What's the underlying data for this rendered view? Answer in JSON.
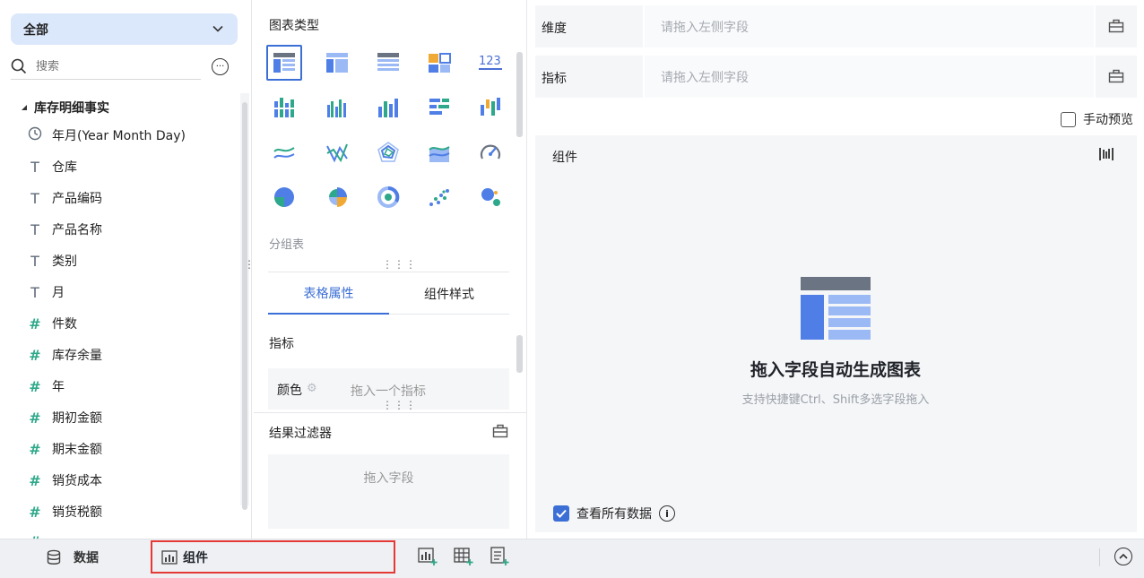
{
  "left": {
    "scope": "全部",
    "search_placeholder": "搜索",
    "tree_root": "库存明细事实",
    "fields": [
      {
        "label": "年月(Year Month Day)",
        "icon": "clock-icon",
        "type": "date"
      },
      {
        "label": "仓库",
        "icon": "text-type-icon",
        "type": "text"
      },
      {
        "label": "产品编码",
        "icon": "text-type-icon",
        "type": "text"
      },
      {
        "label": "产品名称",
        "icon": "text-type-icon",
        "type": "text"
      },
      {
        "label": "类别",
        "icon": "text-type-icon",
        "type": "text"
      },
      {
        "label": "月",
        "icon": "text-type-icon",
        "type": "text"
      },
      {
        "label": "件数",
        "icon": "number-type-icon",
        "type": "number"
      },
      {
        "label": "库存余量",
        "icon": "number-type-icon",
        "type": "number"
      },
      {
        "label": "年",
        "icon": "number-type-icon",
        "type": "number"
      },
      {
        "label": "期初金额",
        "icon": "number-type-icon",
        "type": "number"
      },
      {
        "label": "期末金额",
        "icon": "number-type-icon",
        "type": "number"
      },
      {
        "label": "销货成本",
        "icon": "number-type-icon",
        "type": "number"
      },
      {
        "label": "销货税额",
        "icon": "number-type-icon",
        "type": "number"
      }
    ]
  },
  "middle": {
    "chart_type_title": "图表类型",
    "selected_type": "分组表",
    "tabs": {
      "table_props": "表格属性",
      "component_style": "组件样式"
    },
    "metric_label": "指标",
    "color_label": "颜色",
    "color_drop": "拖入一个指标",
    "filter_title": "结果过滤器",
    "filter_drop": "拖入字段",
    "kpi_label": "123"
  },
  "right": {
    "dimension_label": "维度",
    "dimension_placeholder": "请拖入左侧字段",
    "metric_label": "指标",
    "metric_placeholder": "请拖入左侧字段",
    "manual_preview": "手动预览",
    "canvas_title": "组件",
    "placeholder_heading": "拖入字段自动生成图表",
    "placeholder_hint": "支持快捷键Ctrl、Shift多选字段拖入",
    "view_all": "查看所有数据"
  },
  "bottom": {
    "data_tab": "数据",
    "component_tab": "组件"
  },
  "colors": {
    "accent": "#3b6fd6",
    "highlight": "#e53935"
  }
}
